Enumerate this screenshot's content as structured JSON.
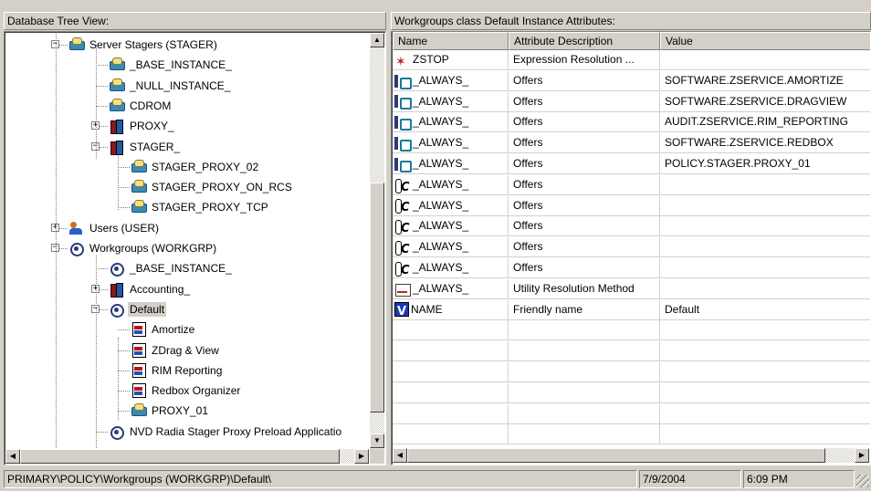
{
  "left_panel": {
    "title": "Database Tree View:",
    "tree": [
      {
        "label": "Server Stagers (STAGER)",
        "icon": "stager-icon",
        "expander": "−"
      },
      {
        "label": "_BASE_INSTANCE_",
        "icon": "stager-icon"
      },
      {
        "label": "_NULL_INSTANCE_",
        "icon": "stager-icon"
      },
      {
        "label": "CDROM",
        "icon": "stager-icon"
      },
      {
        "label": "PROXY_",
        "icon": "books-icon",
        "expander": "+"
      },
      {
        "label": "STAGER_",
        "icon": "books-icon",
        "expander": "−"
      },
      {
        "label": "STAGER_PROXY_02",
        "icon": "stager-icon"
      },
      {
        "label": "STAGER_PROXY_ON_RCS",
        "icon": "stager-icon"
      },
      {
        "label": "STAGER_PROXY_TCP",
        "icon": "stager-icon"
      },
      {
        "label": "Users (USER)",
        "icon": "users-icon",
        "expander": "+"
      },
      {
        "label": "Workgroups (WORKGRP)",
        "icon": "workgroup-icon",
        "expander": "−"
      },
      {
        "label": "_BASE_INSTANCE_",
        "icon": "workgroup-icon"
      },
      {
        "label": "Accounting_",
        "icon": "books-icon",
        "expander": "+"
      },
      {
        "label": "Default",
        "icon": "workgroup-icon",
        "expander": "−",
        "selected": true
      },
      {
        "label": "Amortize",
        "icon": "service-icon"
      },
      {
        "label": "ZDrag & View",
        "icon": "service-icon"
      },
      {
        "label": "RIM Reporting",
        "icon": "service-icon"
      },
      {
        "label": "Redbox Organizer",
        "icon": "service-icon"
      },
      {
        "label": "PROXY_01",
        "icon": "stager-icon"
      },
      {
        "label": "NVD Radia Stager Proxy Preload  Applicatio",
        "icon": "workgroup-icon"
      }
    ]
  },
  "right_panel": {
    "title": "Workgroups class Default Instance Attributes:",
    "columns": [
      "Name",
      "Attribute Description",
      "Value"
    ],
    "rows": [
      {
        "icon": "zstop-icon",
        "name": "ZSTOP",
        "desc": "Expression Resolution ...",
        "value": ""
      },
      {
        "icon": "always-icon",
        "name": "_ALWAYS_",
        "desc": "Offers",
        "value": "SOFTWARE.ZSERVICE.AMORTIZE"
      },
      {
        "icon": "always-icon",
        "name": "_ALWAYS_",
        "desc": "Offers",
        "value": "SOFTWARE.ZSERVICE.DRAGVIEW"
      },
      {
        "icon": "always-icon",
        "name": "_ALWAYS_",
        "desc": "Offers",
        "value": "AUDIT.ZSERVICE.RIM_REPORTING"
      },
      {
        "icon": "always-icon",
        "name": "_ALWAYS_",
        "desc": "Offers",
        "value": "SOFTWARE.ZSERVICE.REDBOX"
      },
      {
        "icon": "always-icon",
        "name": "_ALWAYS_",
        "desc": "Offers",
        "value": "POLICY.STAGER.PROXY_01"
      },
      {
        "icon": "always2-icon",
        "name": "_ALWAYS_",
        "desc": "Offers",
        "value": ""
      },
      {
        "icon": "always2-icon",
        "name": "_ALWAYS_",
        "desc": "Offers",
        "value": ""
      },
      {
        "icon": "always2-icon",
        "name": "_ALWAYS_",
        "desc": "Offers",
        "value": ""
      },
      {
        "icon": "always2-icon",
        "name": "_ALWAYS_",
        "desc": "Offers",
        "value": ""
      },
      {
        "icon": "always2-icon",
        "name": "_ALWAYS_",
        "desc": "Offers",
        "value": ""
      },
      {
        "icon": "utility-icon",
        "name": "_ALWAYS_",
        "desc": "Utility Resolution Method",
        "value": ""
      },
      {
        "icon": "v-icon",
        "name": "NAME",
        "desc": "Friendly name",
        "value": "Default"
      },
      {
        "icon": "",
        "name": "",
        "desc": "",
        "value": ""
      },
      {
        "icon": "",
        "name": "",
        "desc": "",
        "value": ""
      },
      {
        "icon": "",
        "name": "",
        "desc": "",
        "value": ""
      },
      {
        "icon": "",
        "name": "",
        "desc": "",
        "value": ""
      },
      {
        "icon": "",
        "name": "",
        "desc": "",
        "value": ""
      },
      {
        "icon": "",
        "name": "",
        "desc": "",
        "value": ""
      }
    ]
  },
  "status_bar": {
    "path": "PRIMARY\\POLICY\\Workgroups (WORKGRP)\\Default\\",
    "date": "7/9/2004",
    "time": "6:09 PM"
  },
  "colors": {
    "face": "#d4d0c8",
    "window": "#ffffff",
    "shadow": "#808080"
  }
}
